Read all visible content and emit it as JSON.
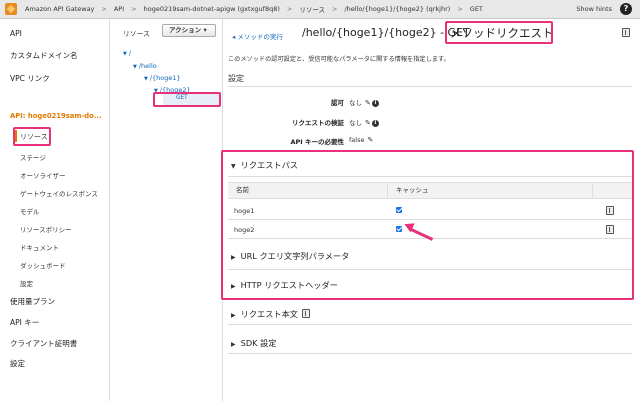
{
  "topbar": {
    "service": "Amazon API Gateway",
    "crumbs": [
      "API",
      "hoge0219sam-dotnet-apigw (gxtxguf8q8)",
      "リソース",
      "/hello/{hoge1}/{hoge2} (qrkjhr)",
      "GET"
    ],
    "hints": "Show hints",
    "help": "?"
  },
  "nav": {
    "api": "API",
    "custom_domain": "カスタムドメイン名",
    "vpc_link": "VPC リンク",
    "api_name": "API: hoge0219sam-do...",
    "resources": "リソース",
    "stages": "ステージ",
    "authorizers": "オーソライザー",
    "gateway_responses": "ゲートウェイのレスポンス",
    "models": "モデル",
    "resource_policy": "リソースポリシー",
    "docs": "ドキュメント",
    "dashboard": "ダッシュボード",
    "settings_sub": "設定",
    "usage_plans": "使用量プラン",
    "api_keys": "API キー",
    "client_certs": "クライアント証明書",
    "settings": "設定"
  },
  "tree": {
    "header": "リソース",
    "action": "アクション ▾",
    "root": "/",
    "hello": "/hello",
    "hoge1": "/{hoge1}",
    "hoge2": "/{hoge2}",
    "method": "GET"
  },
  "main": {
    "back": "◂ メソッドの実行",
    "title": "/hello/{hoge1}/{hoge2} - GET",
    "title_highlight": "メソッドリクエスト",
    "description": "このメソッドの認可設定と、受信可能なパラメータに関する情報を指定します。",
    "settings_header": "設定",
    "auth_label": "認可",
    "auth_value": "なし",
    "validator_label": "リクエストの検証",
    "validator_value": "なし",
    "apikey_label": "API キーの必要性",
    "apikey_value": "false",
    "paths_title": "リクエストパス",
    "col_name": "名前",
    "col_cache": "キャッシュ",
    "rows": [
      {
        "name": "hoge1",
        "cache": true
      },
      {
        "name": "hoge2",
        "cache": true
      }
    ],
    "query_title": "URL クエリ文字列パラメータ",
    "headers_title": "HTTP リクエストヘッダー",
    "body_title": "リクエスト本文",
    "sdk_title": "SDK 設定"
  },
  "colors": {
    "highlight": "#e8317a",
    "accent": "#e07b00",
    "link": "#1166bb"
  }
}
